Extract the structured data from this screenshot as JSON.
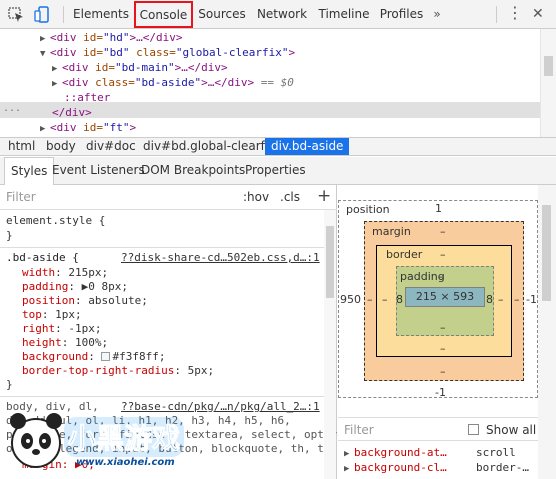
{
  "toolbar": {
    "tabs": [
      "Elements",
      "Console",
      "Sources",
      "Network",
      "Timeline",
      "Profiles"
    ],
    "more_label": "⋮",
    "close_label": "✕"
  },
  "dom": {
    "lines": [
      {
        "pre": "▶",
        "tag": "<div ",
        "attr": "id=",
        "val": "\"hd\"",
        "tail": ">…</div>"
      },
      {
        "pre": "▼",
        "tag": "<div ",
        "attr": "id=",
        "val": "\"bd\"",
        "attr2": " class=",
        "val2": "\"global-clearfix\"",
        "tail": ">"
      },
      {
        "pre": "▶",
        "tag": "<div ",
        "attr": "id=",
        "val": "\"bd-main\"",
        "tail": ">…</div>"
      },
      {
        "pre": "▶",
        "tag": "<div ",
        "attr": "class=",
        "val": "\"bd-aside\"",
        "tail": ">…</div>",
        "suffix": " == $0"
      },
      {
        "text": "::after"
      },
      {
        "text": "</div>"
      },
      {
        "pre": "▶",
        "tag": "<div ",
        "attr": "id=",
        "val": "\"ft\"",
        "tail": ">"
      }
    ],
    "ellipsis": "..."
  },
  "breadcrumbs": {
    "items": [
      "html",
      "body",
      "div#doc",
      "div#bd.global-clearfix"
    ],
    "active": "div.bd-aside"
  },
  "side_tabs": {
    "items": [
      "Styles",
      "Event Listeners",
      "DOM Breakpoints",
      "Properties"
    ]
  },
  "styles": {
    "filter_placeholder": "Filter",
    "hov": ":hov",
    "cls": ".cls",
    "plus": "+",
    "element_style": "element.style {",
    "close_brace": "}",
    "rule_selector": ".bd-aside {",
    "rule_source": "??disk-share-cd…502eb.css,d…:1",
    "props": [
      {
        "name": "width",
        "value": "215px;"
      },
      {
        "name": "padding",
        "value": "▶0 8px;"
      },
      {
        "name": "position",
        "value": "absolute;"
      },
      {
        "name": "top",
        "value": "1px;"
      },
      {
        "name": "right",
        "value": "-1px;"
      },
      {
        "name": "height",
        "value": "100%;"
      },
      {
        "name": "background",
        "value": "#f3f8ff;"
      },
      {
        "name": "border-top-right-radius",
        "value": "5px;"
      }
    ],
    "rule2_selector": "body, div, dl,",
    "rule2_source": "??base-cdn/pkg/…n/pkg/all_2…:1",
    "rule2_lines": [
      "dt, dd, ul, ol, li, h1, h2, h3, h4, h5, h6,",
      "pre, code, form, fieldset, textarea, select, optgroup,",
      "option, legend, input, button, blockquote, th, td",
      "margin: ▶0;"
    ]
  },
  "box_model": {
    "position_label": "position",
    "position_top": "1",
    "position_left": "950",
    "position_right": "-1",
    "position_bottom": "-1",
    "margin_label": "margin",
    "margin_top": "–",
    "margin_left": "–",
    "margin_right": "–",
    "margin_bottom": "–",
    "border_label": "border",
    "border_top": "–",
    "border_left": "–",
    "border_right": "–",
    "border_bottom": "–",
    "padding_label": "padding",
    "padding_top": "–",
    "padding_left": "8",
    "padding_right": "8",
    "padding_bottom": "–",
    "content_size": "215 × 593"
  },
  "computed": {
    "filter_placeholder": "Filter",
    "show_all": "Show all",
    "rows": [
      {
        "name": "background-at…",
        "value": "scroll"
      },
      {
        "name": "background-cl…",
        "value": "border-…"
      }
    ]
  },
  "watermark": {
    "brand": "小黑游戏",
    "url": "www.xiaohei.com"
  },
  "colors": {
    "accent": "#1a73e8",
    "console_highlight": "#e8141c",
    "margin": "#f9cc9d",
    "border": "#fddd9b",
    "padding": "#c3d08b",
    "content": "#8cb6c0"
  }
}
